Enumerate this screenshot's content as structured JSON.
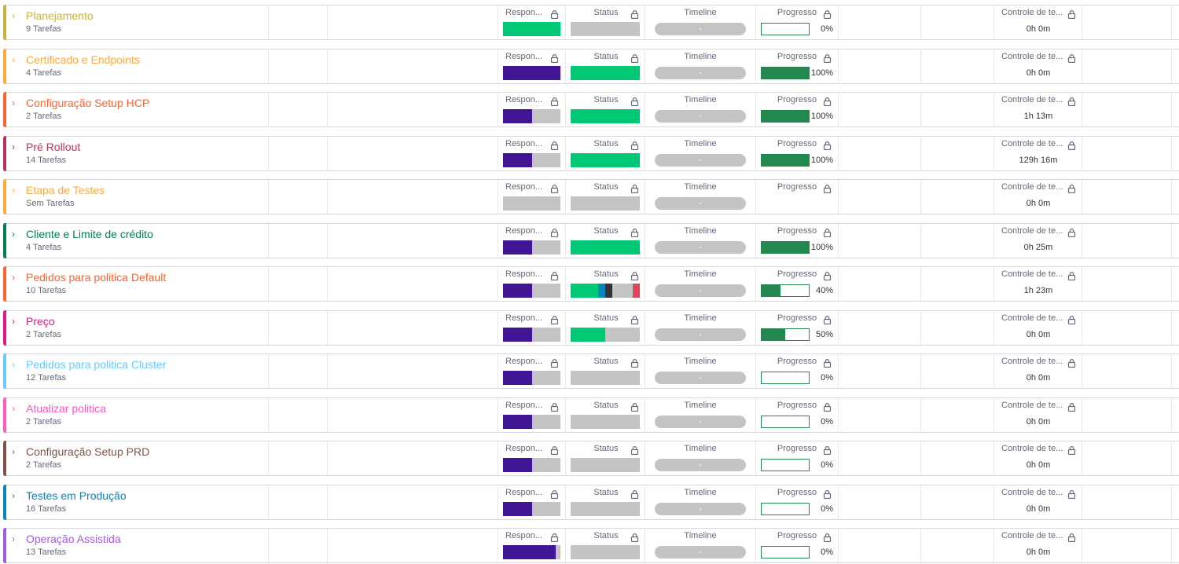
{
  "columns": {
    "responsavel": "Respon...",
    "status": "Status",
    "timeline": "Timeline",
    "progresso": "Progresso",
    "controle": "Controle de te..."
  },
  "icons": {
    "expand": "chevron-right-icon",
    "lock": "lock-icon"
  },
  "colors": {
    "purple": "#401694",
    "green": "#00c875",
    "gray": "#c4c4c4",
    "blue": "#0086c0",
    "dark": "#333333",
    "red": "#e2445c",
    "progress": "#258750"
  },
  "groups": [
    {
      "title": "Planejamento",
      "count": "9 Tarefas",
      "color": "#c9b33d",
      "responsavel": [
        {
          "c": "#00c875",
          "w": 1
        }
      ],
      "status": [
        {
          "c": "#c4c4c4",
          "w": 1
        }
      ],
      "timeline": "-",
      "progress": 0,
      "progress_label": "0%",
      "time": "0h 0m"
    },
    {
      "title": "Certificado e Endpoints",
      "count": "4 Tarefas",
      "color": "#fdab3d",
      "responsavel": [
        {
          "c": "#401694",
          "w": 1
        }
      ],
      "status": [
        {
          "c": "#00c875",
          "w": 1
        }
      ],
      "timeline": "-",
      "progress": 1,
      "progress_label": "100%",
      "time": "0h 0m"
    },
    {
      "title": "Configuração Setup HCP",
      "count": "2 Tarefas",
      "color": "#ff642e",
      "responsavel": [
        {
          "c": "#401694",
          "w": 0.5
        },
        {
          "c": "#c4c4c4",
          "w": 0.5
        }
      ],
      "status": [
        {
          "c": "#00c875",
          "w": 1
        }
      ],
      "timeline": "-",
      "progress": 1,
      "progress_label": "100%",
      "time": "1h 13m"
    },
    {
      "title": "Pré Rollout",
      "count": "14 Tarefas",
      "color": "#bb3354",
      "responsavel": [
        {
          "c": "#401694",
          "w": 0.5
        },
        {
          "c": "#c4c4c4",
          "w": 0.5
        }
      ],
      "status": [
        {
          "c": "#00c875",
          "w": 1
        }
      ],
      "timeline": "-",
      "progress": 1,
      "progress_label": "100%",
      "time": "129h 16m"
    },
    {
      "title": "Etapa de Testes",
      "count": "Sem Tarefas",
      "color": "#fdab3d",
      "responsavel": [
        {
          "c": "#c4c4c4",
          "w": 1
        }
      ],
      "status": [
        {
          "c": "#c4c4c4",
          "w": 1
        }
      ],
      "timeline": "-",
      "progress": null,
      "progress_label": "",
      "time": "0h 0m"
    },
    {
      "title": "Cliente e Limite de crédito",
      "count": "4 Tarefas",
      "color": "#037f4c",
      "responsavel": [
        {
          "c": "#401694",
          "w": 0.5
        },
        {
          "c": "#c4c4c4",
          "w": 0.5
        }
      ],
      "status": [
        {
          "c": "#00c875",
          "w": 1
        }
      ],
      "timeline": "-",
      "progress": 1,
      "progress_label": "100%",
      "time": "0h 25m"
    },
    {
      "title": "Pedidos para politica Default",
      "count": "10 Tarefas",
      "color": "#ff642e",
      "responsavel": [
        {
          "c": "#401694",
          "w": 0.5
        },
        {
          "c": "#c4c4c4",
          "w": 0.5
        }
      ],
      "status": [
        {
          "c": "#00c875",
          "w": 0.4
        },
        {
          "c": "#0086c0",
          "w": 0.1
        },
        {
          "c": "#333333",
          "w": 0.1
        },
        {
          "c": "#c4c4c4",
          "w": 0.3
        },
        {
          "c": "#e2445c",
          "w": 0.1
        }
      ],
      "timeline": "-",
      "progress": 0.4,
      "progress_label": "40%",
      "time": "1h 23m"
    },
    {
      "title": "Preço",
      "count": "2 Tarefas",
      "color": "#e2198a",
      "responsavel": [
        {
          "c": "#401694",
          "w": 0.5
        },
        {
          "c": "#c4c4c4",
          "w": 0.5
        }
      ],
      "status": [
        {
          "c": "#00c875",
          "w": 0.5
        },
        {
          "c": "#c4c4c4",
          "w": 0.5
        }
      ],
      "timeline": "-",
      "progress": 0.5,
      "progress_label": "50%",
      "time": "0h 0m"
    },
    {
      "title": "Pedidos para politica Cluster",
      "count": "12 Tarefas",
      "color": "#66ccff",
      "responsavel": [
        {
          "c": "#401694",
          "w": 0.5
        },
        {
          "c": "#c4c4c4",
          "w": 0.5
        }
      ],
      "status": [
        {
          "c": "#c4c4c4",
          "w": 1
        }
      ],
      "timeline": "-",
      "progress": 0,
      "progress_label": "0%",
      "time": "0h 0m"
    },
    {
      "title": "Atualizar politica",
      "count": "2 Tarefas",
      "color": "#ff5ac4",
      "responsavel": [
        {
          "c": "#401694",
          "w": 0.5
        },
        {
          "c": "#c4c4c4",
          "w": 0.5
        }
      ],
      "status": [
        {
          "c": "#c4c4c4",
          "w": 1
        }
      ],
      "timeline": "-",
      "progress": 0,
      "progress_label": "0%",
      "time": "0h 0m"
    },
    {
      "title": "Configuração Setup PRD",
      "count": "2 Tarefas",
      "color": "#7f5347",
      "responsavel": [
        {
          "c": "#401694",
          "w": 0.5
        },
        {
          "c": "#c4c4c4",
          "w": 0.5
        }
      ],
      "status": [
        {
          "c": "#c4c4c4",
          "w": 1
        }
      ],
      "timeline": "-",
      "progress": 0,
      "progress_label": "0%",
      "time": "0h 0m"
    },
    {
      "title": "Testes em Produção",
      "count": "16 Tarefas",
      "color": "#0a86b8",
      "responsavel": [
        {
          "c": "#401694",
          "w": 0.5
        },
        {
          "c": "#c4c4c4",
          "w": 0.5
        }
      ],
      "status": [
        {
          "c": "#c4c4c4",
          "w": 1
        }
      ],
      "timeline": "-",
      "progress": 0,
      "progress_label": "0%",
      "time": "0h 0m"
    },
    {
      "title": "Operação Assistida",
      "count": "13 Tarefas",
      "color": "#a25ddc",
      "responsavel": [
        {
          "c": "#401694",
          "w": 0.92
        },
        {
          "c": "#c4c4c4",
          "w": 0.08
        }
      ],
      "status": [
        {
          "c": "#c4c4c4",
          "w": 1
        }
      ],
      "timeline": "-",
      "progress": 0,
      "progress_label": "0%",
      "time": "0h 0m"
    }
  ]
}
